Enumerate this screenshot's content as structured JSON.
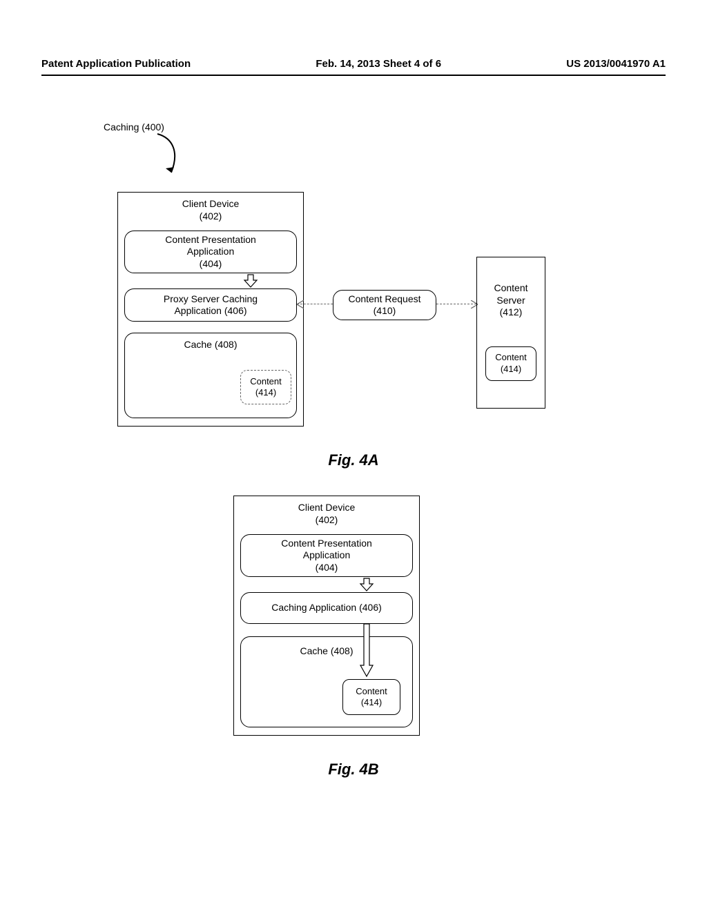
{
  "header": {
    "left": "Patent Application Publication",
    "mid": "Feb. 14, 2013  Sheet 4 of 6",
    "right": "US 2013/0041970 A1"
  },
  "figA": {
    "caption": "Fig. 4A",
    "title": "Caching (400)",
    "clientDevice": "Client Device\n(402)",
    "cpa": "Content Presentation\nApplication\n(404)",
    "proxy": "Proxy Server Caching\nApplication (406)",
    "cache": "Cache (408)",
    "cacheContent": "Content\n(414)",
    "contentRequest": "Content Request\n(410)",
    "server": "Content\nServer\n(412)",
    "serverContent": "Content\n(414)"
  },
  "figB": {
    "caption": "Fig. 4B",
    "clientDevice": "Client Device\n(402)",
    "cpa": "Content Presentation\nApplication\n(404)",
    "caching": "Caching Application (406)",
    "cache": "Cache (408)",
    "content": "Content\n(414)"
  }
}
